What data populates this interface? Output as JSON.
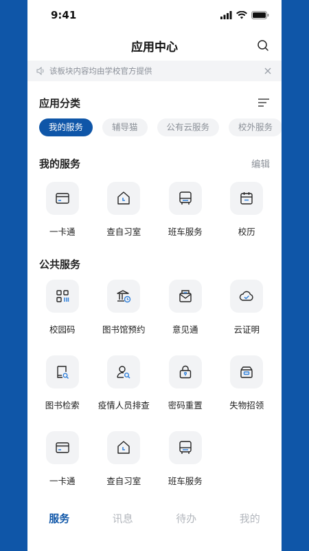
{
  "status": {
    "time": "9:41"
  },
  "nav": {
    "title": "应用中心",
    "search_icon": "search-icon"
  },
  "notice": {
    "text": "该板块内容均由学校官方提供",
    "icon": "speaker-icon"
  },
  "categories": {
    "title": "应用分类",
    "chips": [
      "我的服务",
      "辅导猫",
      "公有云服务",
      "校外服务"
    ],
    "active_index": 0
  },
  "my_services": {
    "title": "我的服务",
    "edit_label": "编辑",
    "apps": [
      {
        "label": "一卡通",
        "icon": "card-icon"
      },
      {
        "label": "查自习室",
        "icon": "study-room-icon"
      },
      {
        "label": "班车服务",
        "icon": "bus-icon"
      },
      {
        "label": "校历",
        "icon": "calendar-icon"
      }
    ]
  },
  "public_services": {
    "title": "公共服务",
    "apps": [
      {
        "label": "校园码",
        "icon": "qr-code-icon"
      },
      {
        "label": "图书馆预约",
        "icon": "library-icon"
      },
      {
        "label": "意见通",
        "icon": "mail-icon"
      },
      {
        "label": "云证明",
        "icon": "cloud-check-icon"
      },
      {
        "label": "图书检索",
        "icon": "book-search-icon"
      },
      {
        "label": "疫情人员排查",
        "icon": "person-search-icon"
      },
      {
        "label": "密码重置",
        "icon": "lock-icon"
      },
      {
        "label": "失物招领",
        "icon": "lost-found-icon"
      },
      {
        "label": "一卡通",
        "icon": "card-icon"
      },
      {
        "label": "查自习室",
        "icon": "study-room-icon"
      },
      {
        "label": "班车服务",
        "icon": "bus-icon"
      }
    ]
  },
  "tabbar": {
    "tabs": [
      "服务",
      "讯息",
      "待办",
      "我的"
    ],
    "active_index": 0
  },
  "colors": {
    "brand": "#0f56a8",
    "accent_blue": "#2f7fd9"
  }
}
